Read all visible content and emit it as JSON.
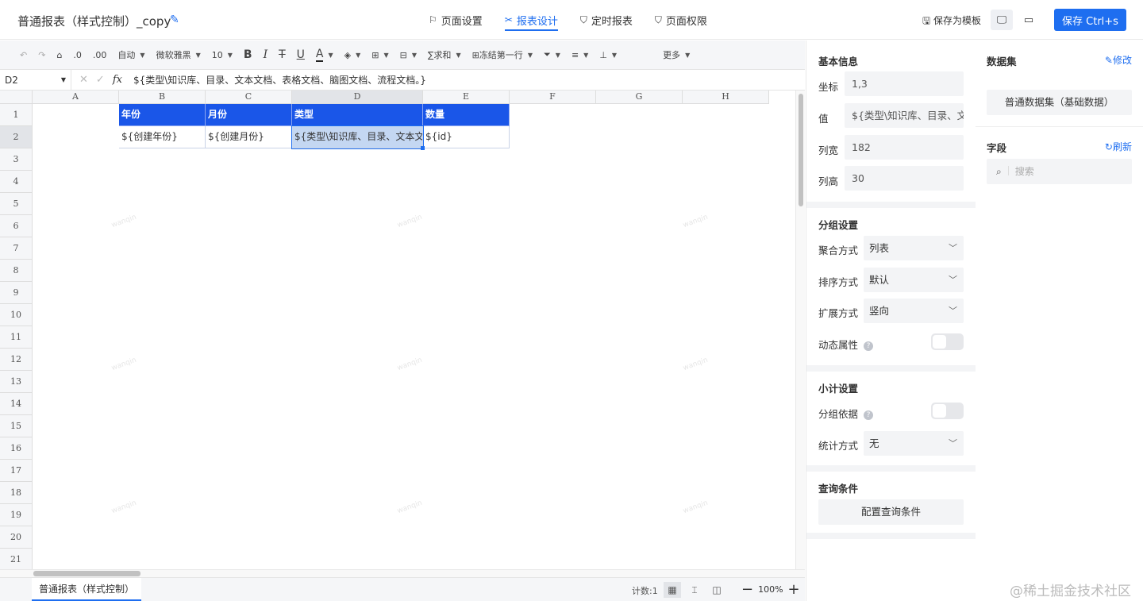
{
  "header": {
    "title": "普通报表（样式控制）_copy",
    "nav": [
      {
        "label": "页面设置",
        "icon": "bookmark-icon"
      },
      {
        "label": "报表设计",
        "icon": "design-icon",
        "active": true
      },
      {
        "label": "定时报表",
        "icon": "shield-clock-icon"
      },
      {
        "label": "页面权限",
        "icon": "shield-icon"
      }
    ],
    "save_template": "保存为模板",
    "save_button": "保存 Ctrl+s"
  },
  "toolbar": {
    "auto": "自动",
    "font": "微软雅黑",
    "size": "10",
    "bold": "B",
    "italic": "I",
    "strike": "T",
    "underline": "U",
    "font_color": "A",
    "sum": "求和",
    "freeze": "冻结第一行",
    "more": "更多"
  },
  "formula_bar": {
    "cell_ref": "D2",
    "fx": "fx",
    "value": "${类型\\知识库、目录、文本文档、表格文档、脑图文档、流程文档。}"
  },
  "sheet": {
    "columns": [
      "A",
      "B",
      "C",
      "D",
      "E",
      "F",
      "G",
      "H"
    ],
    "rows": [
      "1",
      "2",
      "3",
      "4",
      "5",
      "6",
      "7",
      "8",
      "9",
      "10",
      "11",
      "12",
      "13",
      "14",
      "15",
      "16",
      "17",
      "18",
      "19",
      "20",
      "21"
    ],
    "header_cells": [
      "年份",
      "月份",
      "类型",
      "数量"
    ],
    "data_cells": [
      "${创建年份}",
      "${创建月份}",
      "${类型\\知识库、目录、文本文档、表格文档、脑图文档、流程文档。}",
      "${id}"
    ],
    "selected_cell": "D2",
    "watermark": "wanqin"
  },
  "footer": {
    "sheet_tab": "普通报表（样式控制）",
    "count": "计数:1",
    "zoom": "100%"
  },
  "props": {
    "basic_title": "基本信息",
    "coord_label": "坐标",
    "coord_value": "1,3",
    "value_label": "值",
    "value_value": "${类型\\知识库、目录、文本文档、表格文档、脑图文档、流程文档。}",
    "colwidth_label": "列宽",
    "colwidth_value": "182",
    "rowheight_label": "列高",
    "rowheight_value": "30",
    "group_title": "分组设置",
    "agg_label": "聚合方式",
    "agg_value": "列表",
    "sort_label": "排序方式",
    "sort_value": "默认",
    "expand_label": "扩展方式",
    "expand_value": "竖向",
    "dynamic_label": "动态属性",
    "subtotal_title": "小计设置",
    "groupby_label": "分组依据",
    "stat_label": "统计方式",
    "stat_value": "无",
    "query_title": "查询条件",
    "query_button": "配置查询条件"
  },
  "dataset": {
    "title": "数据集",
    "edit": "修改",
    "dataset_button": "普通数据集（基础数据）",
    "fields_title": "字段",
    "refresh": "刷新",
    "search_placeholder": "搜索"
  },
  "brand": "@稀土掘金技术社区",
  "colors": {
    "accent": "#1e6ef0",
    "header_cell": "#1a56e8",
    "selected_cell": "#c4d7f2"
  }
}
